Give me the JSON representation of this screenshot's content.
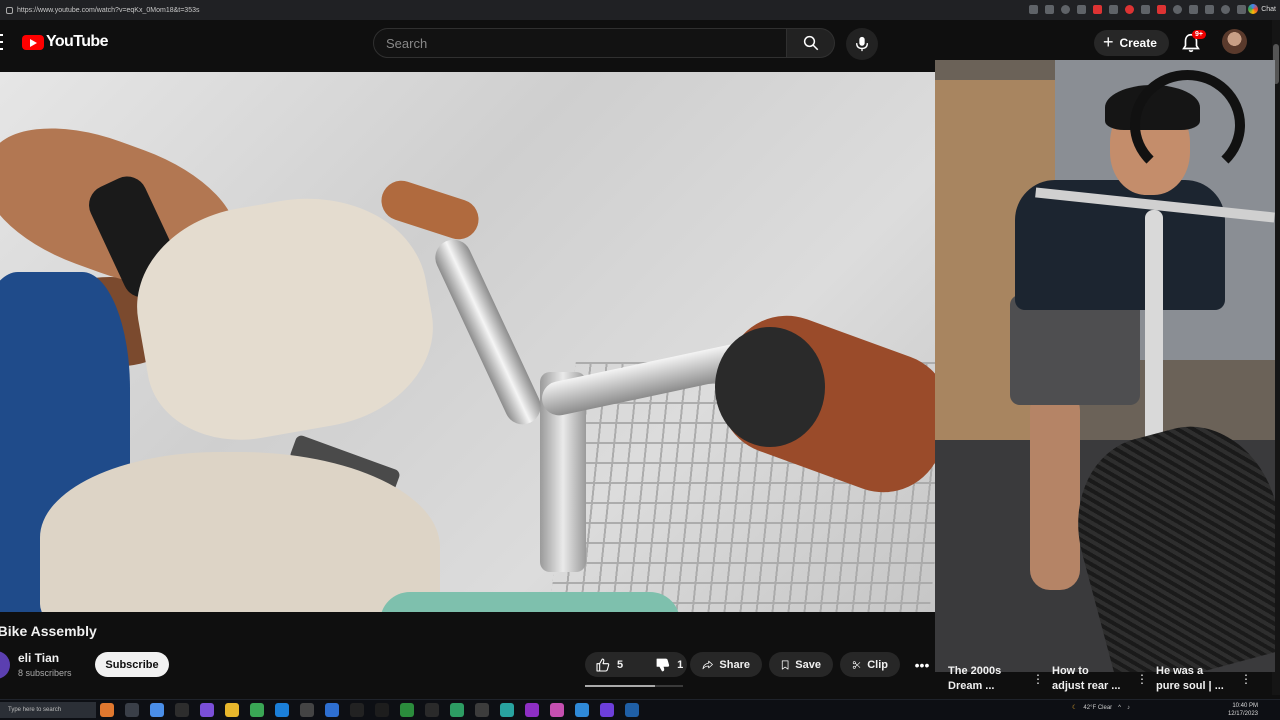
{
  "browser": {
    "url": "https://www.youtube.com/watch?v=eqKx_0Mom18&t=353s",
    "chat_label": "Chat"
  },
  "header": {
    "logo_text": "YouTube",
    "search_placeholder": "Search",
    "create_label": "Create",
    "notification_count": "9+"
  },
  "video": {
    "title": "y Bike Assembly",
    "channel_name": "eli Tian",
    "subscribers": "8 subscribers",
    "subscribe_label": "Subscribe"
  },
  "actions": {
    "like_count": "5",
    "dislike_count": "1",
    "share_label": "Share",
    "save_label": "Save",
    "clip_label": "Clip"
  },
  "recommendations": [
    {
      "title_line1": "The 2000s",
      "title_line2": "Dream ..."
    },
    {
      "title_line1": "How to",
      "title_line2": "adjust rear ..."
    },
    {
      "title_line1": "He was a",
      "title_line2": "pure soul | ..."
    }
  ],
  "taskbar": {
    "search_placeholder": "Type here to search",
    "weather": "42°F Clear",
    "time": "10:40 PM",
    "date": "12/17/2023"
  },
  "colors": {
    "accent": "#ff0000",
    "background": "#0f0f0f",
    "pill": "#272727"
  }
}
